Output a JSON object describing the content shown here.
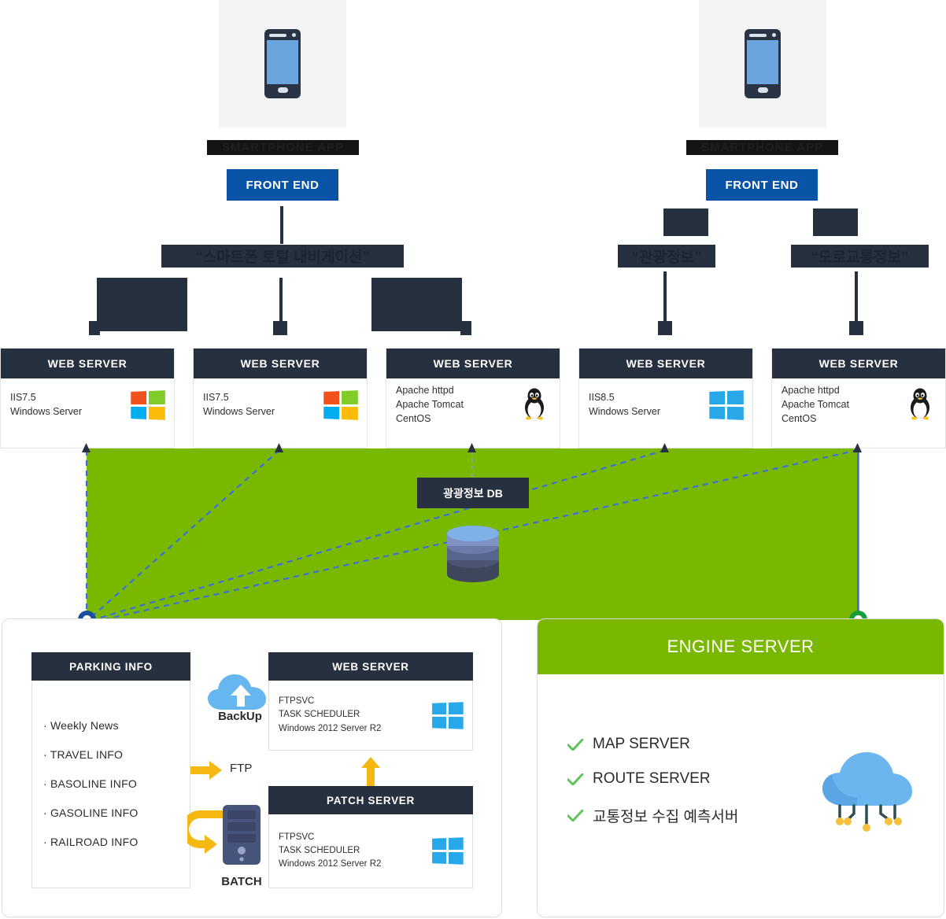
{
  "theme": {
    "navy": "#27303f",
    "blue_button": "#0a54a8",
    "green_band": "#7ab800",
    "yellow_arrow": "#f5b712",
    "dashed_line": "#3b6fe0",
    "check_green": "#5fc45f",
    "ring_blue": "#1a4f9c",
    "ring_green": "#199c3c"
  },
  "top": {
    "clients": [
      {
        "photo_alt": "smartphone-photo",
        "caption": "SMARTPHONE APP",
        "frontend_label": "FRONT END"
      },
      {
        "photo_alt": "smartphone-photo",
        "caption": "SMARTPHONE APP",
        "frontend_label": "FRONT END"
      }
    ],
    "service_tags": [
      "“스마트폰 토털 내비게이션”",
      "“관광정보”",
      "“도로교통정보”"
    ]
  },
  "web_servers": [
    {
      "title": "WEB SERVER",
      "lines": [
        "IIS7.5",
        "Windows Server"
      ],
      "icon": "windows-classic-icon"
    },
    {
      "title": "WEB SERVER",
      "lines": [
        "IIS7.5",
        "Windows Server"
      ],
      "icon": "windows-classic-icon"
    },
    {
      "title": "WEB SERVER",
      "lines": [
        "Apache httpd",
        "Apache Tomcat",
        "CentOS"
      ],
      "icon": "linux-tux-icon"
    },
    {
      "title": "WEB SERVER",
      "lines": [
        "IIS8.5",
        "Windows Server"
      ],
      "icon": "windows-modern-icon"
    },
    {
      "title": "WEB SERVER",
      "lines": [
        "Apache httpd",
        "Apache Tomcat",
        "CentOS"
      ],
      "icon": "linux-tux-icon"
    }
  ],
  "database": {
    "label": "광광정보 DB",
    "icon": "database-cylinder-icon"
  },
  "parking_panel": {
    "title": "PARKING INFO",
    "items": [
      "· Weekly News",
      "· TRAVEL INFO",
      "· BASOLINE INFO",
      "· GASOLINE INFO",
      "· RAILROAD INFO"
    ],
    "backup_label": "BackUp",
    "backup_icon": "cloud-upload-icon",
    "ftp_label": "FTP",
    "batch_label": "BATCH",
    "batch_icon": "server-tower-icon",
    "web_server": {
      "title": "WEB SERVER",
      "lines": [
        "FTPSVC",
        "TASK SCHEDULER",
        "Windows 2012 Server R2"
      ],
      "icon": "windows-modern-icon"
    },
    "patch_server": {
      "title": "PATCH SERVER",
      "lines": [
        "FTPSVC",
        "TASK SCHEDULER",
        "Windows 2012 Server R2"
      ],
      "icon": "windows-modern-icon"
    }
  },
  "engine_panel": {
    "title": "ENGINE SERVER",
    "icon": "cloud-iot-icon",
    "items": [
      "MAP SERVER",
      "ROUTE SERVER",
      "교통정보 수집 예측서버"
    ]
  }
}
